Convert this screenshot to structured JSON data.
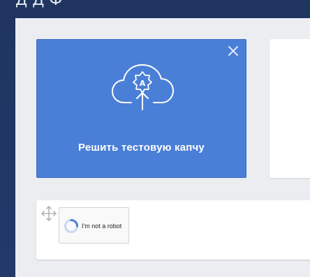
{
  "header": {
    "title_fragment": "ДДФ"
  },
  "captcha_card": {
    "title": "Решить тестовую капчу",
    "cloud_badge_letter": "A",
    "icons": {
      "upload": "cloud-upload-icon",
      "close": "close-icon"
    },
    "colors": {
      "background": "#4a7fd8",
      "text": "#ffffff"
    }
  },
  "widget": {
    "label": "I'm not a robot",
    "icons": {
      "drag": "move-arrows-icon",
      "loading": "spinner-icon"
    }
  },
  "colors": {
    "navbar": "#1f3560",
    "content_background": "#ebedf1",
    "card": "#ffffff",
    "accent": "#4a7fd8"
  }
}
